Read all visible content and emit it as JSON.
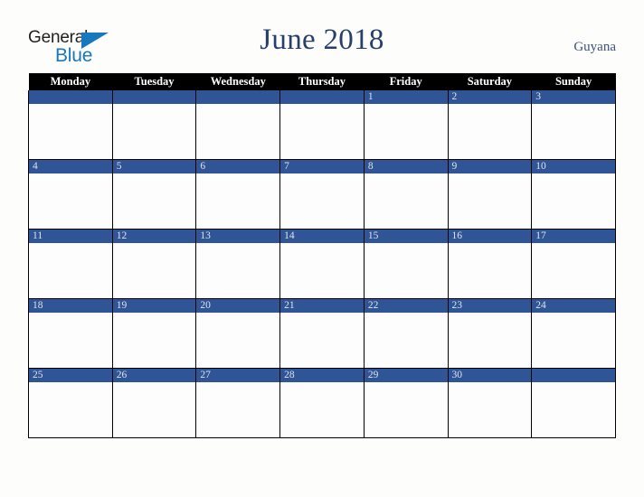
{
  "logo": {
    "word_one": "General",
    "word_two": "Blue",
    "triangle_icon": "triangle-icon",
    "accent_color": "#1878be"
  },
  "header": {
    "title": "June 2018",
    "country": "Guyana",
    "title_color": "#27406b"
  },
  "calendar": {
    "weekday_headers": [
      "Monday",
      "Tuesday",
      "Wednesday",
      "Thursday",
      "Friday",
      "Saturday",
      "Sunday"
    ],
    "header_bg": "#000000",
    "band_color": "#2f5597",
    "weeks": [
      [
        "",
        "",
        "",
        "",
        "1",
        "2",
        "3"
      ],
      [
        "4",
        "5",
        "6",
        "7",
        "8",
        "9",
        "10"
      ],
      [
        "11",
        "12",
        "13",
        "14",
        "15",
        "16",
        "17"
      ],
      [
        "18",
        "19",
        "20",
        "21",
        "22",
        "23",
        "24"
      ],
      [
        "25",
        "26",
        "27",
        "28",
        "29",
        "30",
        ""
      ]
    ]
  }
}
